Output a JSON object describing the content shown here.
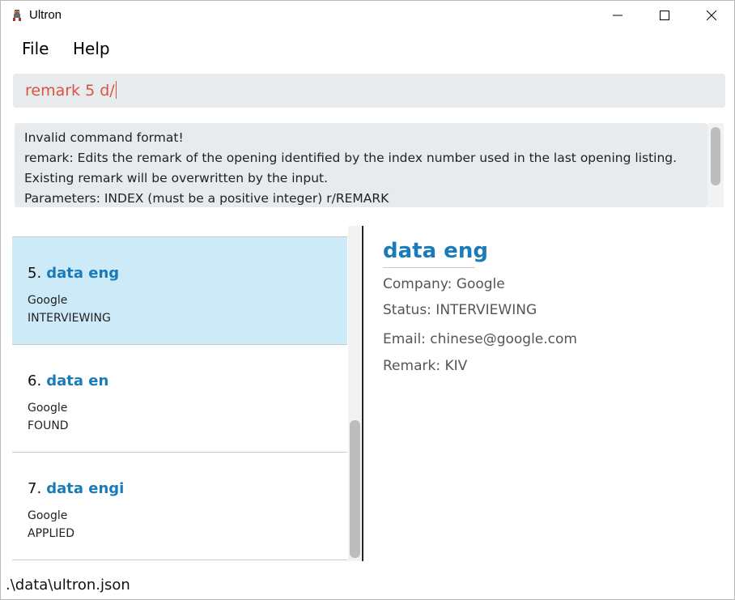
{
  "window": {
    "title": "Ultron"
  },
  "menu": {
    "file_label": "File",
    "help_label": "Help"
  },
  "command": {
    "value": "remark 5 d/"
  },
  "result": {
    "text": "Invalid command format!\nremark: Edits the remark of the opening identified by the index number used in the last opening listing.\nExisting remark will be overwritten by the input.\nParameters: INDEX (must be a positive integer) r/REMARK"
  },
  "list": {
    "items": [
      {
        "index": "5.",
        "name": "data eng",
        "company": "Google",
        "status": "INTERVIEWING",
        "selected": true
      },
      {
        "index": "6.",
        "name": "data en",
        "company": "Google",
        "status": "FOUND",
        "selected": false
      },
      {
        "index": "7.",
        "name": "data engi",
        "company": "Google",
        "status": "APPLIED",
        "selected": false
      }
    ]
  },
  "detail": {
    "title": "data eng",
    "company": "Company: Google",
    "status": "Status: INTERVIEWING",
    "email": "Email: chinese@google.com",
    "remark": "Remark: KIV"
  },
  "status_bar": {
    "path": ".\\data\\ultron.json"
  },
  "colors": {
    "accent": "#1a7bb8",
    "command_text": "#d9533f",
    "selected_bg": "#cdeaf8",
    "input_bg": "#e8ebee"
  },
  "icons": {
    "app": "app-icon",
    "minimize": "minimize-icon",
    "maximize": "maximize-icon",
    "close": "close-icon"
  }
}
